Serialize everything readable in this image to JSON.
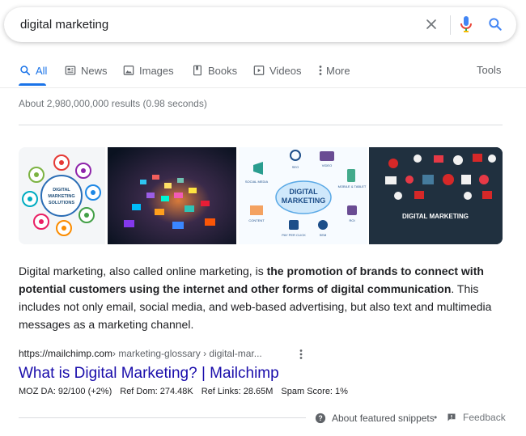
{
  "search": {
    "query": "digital marketing",
    "clear_label": "Clear",
    "voice_label": "Search by voice",
    "submit_label": "Search"
  },
  "tabs": {
    "all": "All",
    "news": "News",
    "images": "Images",
    "books": "Books",
    "videos": "Videos",
    "more": "More",
    "tools": "Tools",
    "active": "all"
  },
  "stats": "About 2,980,000,000 results (0.98 seconds)",
  "images": [
    {
      "icon": "digital-marketing-solutions-infographic",
      "caption": "DIGITAL MARKETING SOLUTIONS"
    },
    {
      "icon": "abstract-digital-tiles-photo",
      "caption": ""
    },
    {
      "icon": "digital-marketing-diagram",
      "caption": "DIGITAL MARKETING"
    },
    {
      "icon": "digital-marketing-icons-dark",
      "caption": "DIGITAL MARKETING"
    }
  ],
  "image_labels": {
    "diagram_seo": "SEO",
    "diagram_video": "VIDEO",
    "diagram_social": "SOCIAL MEDIA",
    "diagram_mobile": "MOBILE & TABLET",
    "diagram_content": "CONTENT",
    "diagram_roi": "ROI",
    "diagram_ppc": "PAY PER CLICK",
    "diagram_sem": "SEM"
  },
  "snippet": {
    "part1": "Digital marketing, also called online marketing, is ",
    "bold": "the promotion of brands to connect with potential customers using the internet and other forms of digital communication",
    "part2": ". This includes not only email, social media, and web-based advertising, but also text and multimedia messages as a marketing channel."
  },
  "result": {
    "cite_domain": "https://mailchimp.com",
    "cite_path": " › marketing-glossary › digital-mar...",
    "title": "What is Digital Marketing? | Mailchimp",
    "moz_da": "MOZ DA: 92/100 (+2%)",
    "ref_dom": "Ref Dom: 274.48K",
    "ref_links": "Ref Links: 28.65M",
    "spam_score": "Spam Score: 1%"
  },
  "footer": {
    "about": "About featured snippets",
    "dot": "•",
    "feedback": "Feedback"
  },
  "colors": {
    "accent": "#1a73e8",
    "link": "#1a0dab",
    "muted": "#70757a"
  }
}
